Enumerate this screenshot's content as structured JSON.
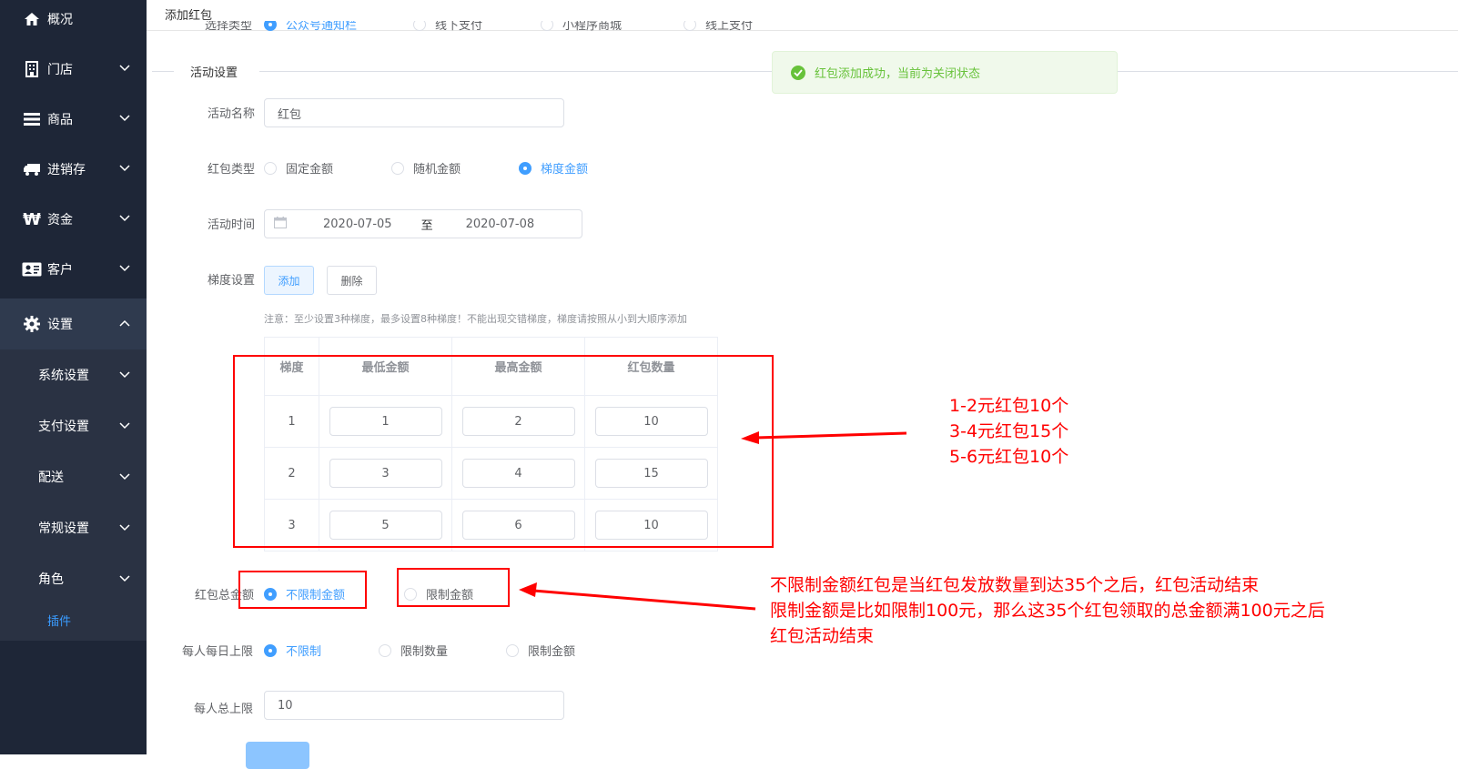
{
  "sidebar": {
    "items": [
      {
        "label": "概况",
        "icon": "home-icon"
      },
      {
        "label": "门店",
        "icon": "building-icon"
      },
      {
        "label": "商品",
        "icon": "list-icon"
      },
      {
        "label": "进销存",
        "icon": "truck-icon"
      },
      {
        "label": "资金",
        "icon": "won-icon"
      },
      {
        "label": "客户",
        "icon": "id-card-icon"
      },
      {
        "label": "设置",
        "icon": "gear-icon"
      }
    ],
    "sub_items": [
      {
        "label": "系统设置"
      },
      {
        "label": "支付设置"
      },
      {
        "label": "配送"
      },
      {
        "label": "常规设置"
      },
      {
        "label": "角色"
      }
    ],
    "plugin_label": "插件"
  },
  "header": {
    "title": "添加红包"
  },
  "clipped_row": {
    "label": "选择类型",
    "options": [
      "公众号通知栏",
      "线下支付",
      "小程序商城",
      "线上支付"
    ]
  },
  "section": {
    "title": "活动设置"
  },
  "toast": {
    "message": "红包添加成功，当前为关闭状态",
    "color": "#67c23a"
  },
  "form": {
    "activity_name": {
      "label": "活动名称",
      "value": "红包"
    },
    "packet_type": {
      "label": "红包类型",
      "options": [
        "固定金额",
        "随机金额",
        "梯度金额"
      ],
      "selected": "梯度金额"
    },
    "activity_time": {
      "label": "活动时间",
      "start": "2020-07-05",
      "sep": "至",
      "end": "2020-07-08"
    },
    "gradient": {
      "label": "梯度设置",
      "add": "添加",
      "delete": "删除",
      "note": "注意：至少设置3种梯度，最多设置8种梯度！不能出现交错梯度，梯度请按照从小到大顺序添加"
    },
    "table": {
      "headers": [
        "梯度",
        "最低金额",
        "最高金额",
        "红包数量"
      ],
      "rows": [
        {
          "level": "1",
          "min": "1",
          "max": "2",
          "count": "10"
        },
        {
          "level": "2",
          "min": "3",
          "max": "4",
          "count": "15"
        },
        {
          "level": "3",
          "min": "5",
          "max": "6",
          "count": "10"
        }
      ]
    },
    "total_amount": {
      "label": "红包总金额",
      "options": [
        "不限制金额",
        "限制金额"
      ],
      "selected": "不限制金额"
    },
    "daily_limit": {
      "label": "每人每日上限",
      "options": [
        "不限制",
        "限制数量",
        "限制金额"
      ],
      "selected": "不限制"
    },
    "total_limit": {
      "label": "每人总上限",
      "value": "10"
    }
  },
  "annotations": {
    "gradient_note": [
      "1-2元红包10个",
      "3-4元红包15个",
      "5-6元红包10个"
    ],
    "limit_note": [
      "不限制金额红包是当红包发放数量到达35个之后，红包活动结束",
      "限制金额是比如限制100元，那么这35个红包领取的总金额满100元之后",
      "红包活动结束"
    ],
    "color": "#ff0000"
  },
  "colors": {
    "primary": "#409eff",
    "sidebar_bg": "#1e2637"
  }
}
